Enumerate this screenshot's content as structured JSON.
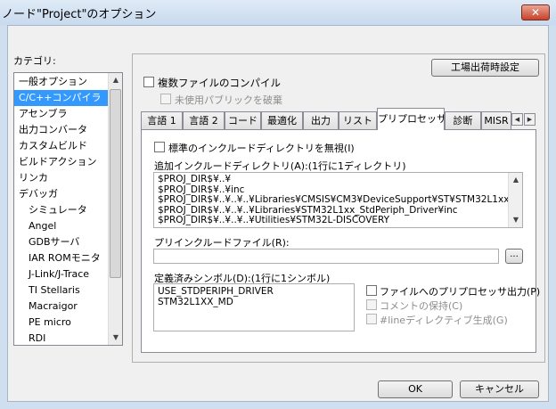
{
  "window": {
    "title": "ノード\"Project\"のオプション",
    "close_label": "✕"
  },
  "category": {
    "label": "カテゴリ:",
    "items": [
      {
        "label": "一般オプション",
        "indent": false,
        "selected": false
      },
      {
        "label": "C/C++コンパイラ",
        "indent": false,
        "selected": true
      },
      {
        "label": "アセンブラ",
        "indent": false,
        "selected": false
      },
      {
        "label": "出力コンバータ",
        "indent": false,
        "selected": false
      },
      {
        "label": "カスタムビルド",
        "indent": false,
        "selected": false
      },
      {
        "label": "ビルドアクション",
        "indent": false,
        "selected": false
      },
      {
        "label": "リンカ",
        "indent": false,
        "selected": false
      },
      {
        "label": "デバッガ",
        "indent": false,
        "selected": false
      },
      {
        "label": "シミュレータ",
        "indent": true,
        "selected": false
      },
      {
        "label": "Angel",
        "indent": true,
        "selected": false
      },
      {
        "label": "GDBサーバ",
        "indent": true,
        "selected": false
      },
      {
        "label": "IAR ROMモニタ",
        "indent": true,
        "selected": false
      },
      {
        "label": "J-Link/J-Trace",
        "indent": true,
        "selected": false
      },
      {
        "label": "TI Stellaris",
        "indent": true,
        "selected": false
      },
      {
        "label": "Macraigor",
        "indent": true,
        "selected": false
      },
      {
        "label": "PE micro",
        "indent": true,
        "selected": false
      },
      {
        "label": "RDI",
        "indent": true,
        "selected": false
      }
    ]
  },
  "factory_settings_label": "工場出荷時設定",
  "multi_file": {
    "label": "複数ファイルのコンパイル",
    "checked": false,
    "discard_public_label": "未使用パブリックを破棄",
    "discard_public_enabled": false
  },
  "tabs": [
    {
      "label": "言語 1",
      "active": false
    },
    {
      "label": "言語 2",
      "active": false
    },
    {
      "label": "コード",
      "active": false
    },
    {
      "label": "最適化",
      "active": false
    },
    {
      "label": "出力",
      "active": false
    },
    {
      "label": "リスト",
      "active": false
    },
    {
      "label": "プリプロセッサ",
      "active": true
    },
    {
      "label": "診断",
      "active": false
    },
    {
      "label": "MISR",
      "active": false
    }
  ],
  "tab_nav": {
    "left": "◀",
    "right": "▶"
  },
  "preprocessor": {
    "ignore_std_include_label": "標準のインクルードディレクトリを無視(I)",
    "ignore_std_include_checked": false,
    "include_dirs_label": "追加インクルードディレクトリ(A):(1行に1ディレクトリ)",
    "include_dirs": [
      "$PROJ_DIR$¥..¥",
      "$PROJ_DIR$¥..¥inc",
      "$PROJ_DIR$¥..¥..¥..¥Libraries¥CMSIS¥CM3¥DeviceSupport¥ST¥STM32L1xx",
      "$PROJ_DIR$¥..¥..¥..¥Libraries¥STM32L1xx_StdPeriph_Driver¥inc",
      "$PROJ_DIR$¥..¥..¥..¥Utilities¥STM32L-DISCOVERY"
    ],
    "preinclude_label": "プリインクルードファイル(R):",
    "preinclude_value": "",
    "browse_label": "...",
    "defined_symbols_label": "定義済みシンボル(D):(1行に1シンボル)",
    "defined_symbols": [
      "USE_STDPERIPH_DRIVER",
      "STM32L1XX_MD"
    ],
    "preprocess_output_label": "ファイルへのプリプロセッサ出力(P)",
    "preprocess_output_checked": false,
    "keep_comments_label": "コメントの保持(C)",
    "keep_comments_enabled": false,
    "line_directives_label": "#lineディレクティブ生成(G)",
    "line_directives_enabled": false
  },
  "scroll_arrows": {
    "up": "▲",
    "down": "▼"
  },
  "ok_label": "OK",
  "cancel_label": "キャンセル"
}
